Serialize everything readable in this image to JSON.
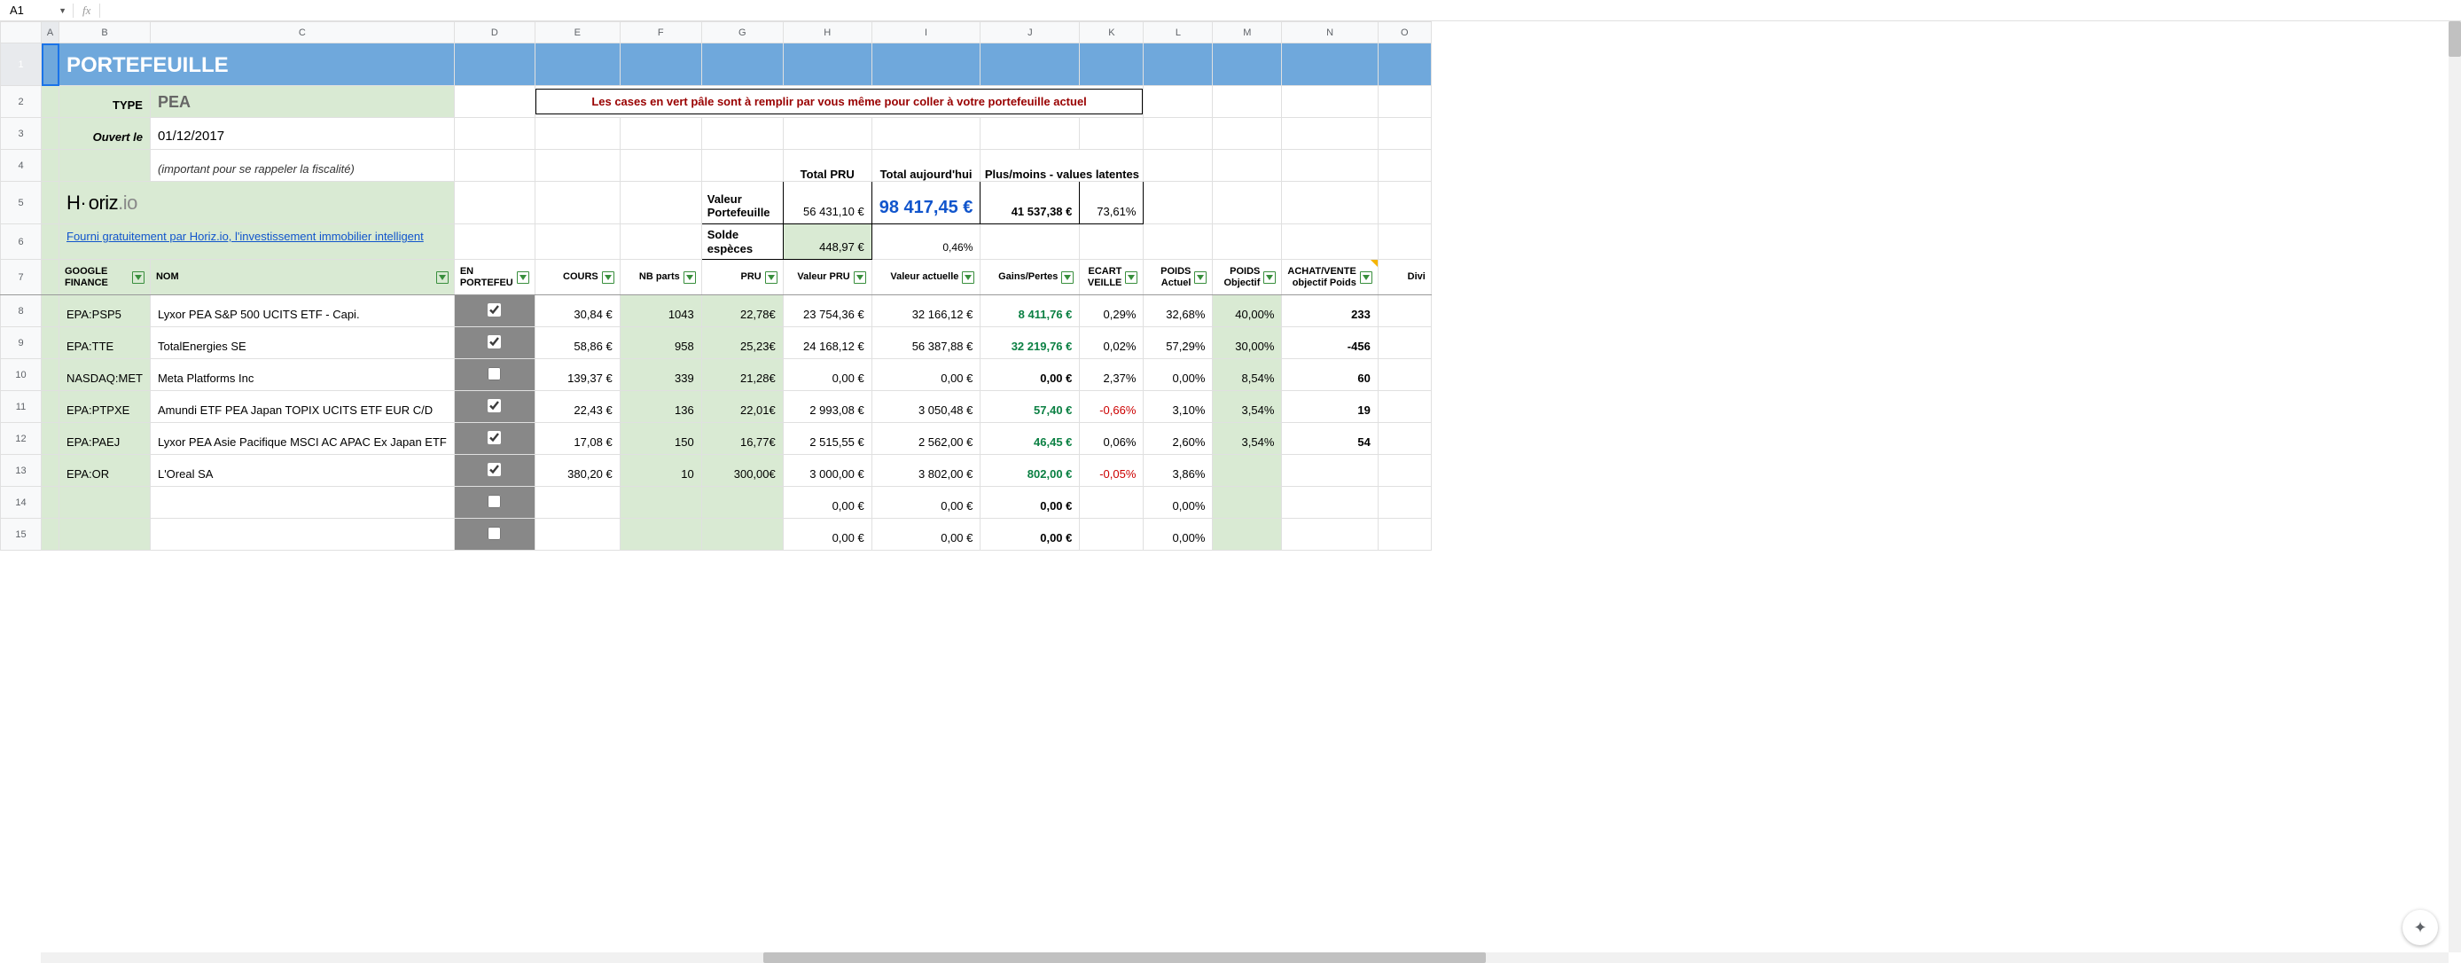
{
  "nameBox": "A1",
  "title": "PORTEFEUILLE",
  "typeLabel": "TYPE",
  "typeValue": "PEA",
  "openLabel": "Ouvert le",
  "openDate": "01/12/2017",
  "openNote": "(important pour se rappeler la fiscalité)",
  "logo": "Horiz.io",
  "logoL1": "H",
  "logoL2": "oriz",
  "logoL3": ".io",
  "link": "Fourni gratuitement par Horiz.io, l'investissement immobilier intelligent",
  "callout": "Les cases en vert pâle sont à remplir par vous même pour coller à votre portefeuille actuel",
  "sumHdr": {
    "pru": "Total PRU",
    "today": "Total aujourd'hui",
    "pm": "Plus/moins - values latentes"
  },
  "sumRows": {
    "valeur": {
      "label": "Valeur Portefeuille",
      "pru": "56 431,10 €",
      "today": "98 417,45 €",
      "pm": "41 537,38 €",
      "pct": "73,61%"
    },
    "solde": {
      "label": "Solde espèces",
      "val": "448,97 €",
      "pct": "0,46%"
    }
  },
  "columns": {
    "google": "GOOGLE FINANCE",
    "nom": "NOM",
    "enport": "EN PORTEFEU",
    "cours": "COURS",
    "nbparts": "NB parts",
    "pru": "PRU",
    "valpru": "Valeur PRU",
    "valact": "Valeur actuelle",
    "gains": "Gains/Pertes",
    "ecart": "ECART VEILLE",
    "pact": "POIDS Actuel",
    "pobj": "POIDS Objectif",
    "achat": "ACHAT/VENTE objectif Poids",
    "divi": "Divi"
  },
  "rows": [
    {
      "sym": "EPA:PSP5",
      "nom": "Lyxor PEA S&P 500 UCITS ETF - Capi.",
      "chk": true,
      "cours": "30,84  €",
      "nb": "1043",
      "pru": "22,78€",
      "vpru": "23 754,36 €",
      "vact": "32 166,12 €",
      "gp": "8 411,76 €",
      "gpc": "green",
      "ecart": "0,29%",
      "ecartc": "",
      "pa": "32,68%",
      "po": "40,00%",
      "av": "233"
    },
    {
      "sym": "EPA:TTE",
      "nom": "TotalEnergies SE",
      "chk": true,
      "cours": "58,86  €",
      "nb": "958",
      "pru": "25,23€",
      "vpru": "24 168,12 €",
      "vact": "56 387,88 €",
      "gp": "32 219,76 €",
      "gpc": "green",
      "ecart": "0,02%",
      "ecartc": "",
      "pa": "57,29%",
      "po": "30,00%",
      "av": "-456"
    },
    {
      "sym": "NASDAQ:MET",
      "nom": "Meta Platforms Inc",
      "chk": false,
      "cours": "139,37  €",
      "nb": "339",
      "pru": "21,28€",
      "vpru": "0,00 €",
      "vact": "0,00 €",
      "gp": "0,00 €",
      "gpc": "",
      "ecart": "2,37%",
      "ecartc": "",
      "pa": "0,00%",
      "po": "8,54%",
      "av": "60"
    },
    {
      "sym": "EPA:PTPXE",
      "nom": "Amundi ETF PEA Japan TOPIX UCITS ETF EUR C/D",
      "chk": true,
      "cours": "22,43  €",
      "nb": "136",
      "pru": "22,01€",
      "vpru": "2 993,08 €",
      "vact": "3 050,48 €",
      "gp": "57,40 €",
      "gpc": "green",
      "ecart": "-0,66%",
      "ecartc": "red",
      "pa": "3,10%",
      "po": "3,54%",
      "av": "19"
    },
    {
      "sym": "EPA:PAEJ",
      "nom": "Lyxor PEA Asie Pacifique MSCI AC APAC Ex Japan ETF",
      "chk": true,
      "cours": "17,08  €",
      "nb": "150",
      "pru": "16,77€",
      "vpru": "2 515,55 €",
      "vact": "2 562,00 €",
      "gp": "46,45 €",
      "gpc": "green",
      "ecart": "0,06%",
      "ecartc": "",
      "pa": "2,60%",
      "po": "3,54%",
      "av": "54"
    },
    {
      "sym": "EPA:OR",
      "nom": "L'Oreal SA",
      "chk": true,
      "cours": "380,20  €",
      "nb": "10",
      "pru": "300,00€",
      "vpru": "3 000,00 €",
      "vact": "3 802,00 €",
      "gp": "802,00 €",
      "gpc": "green",
      "ecart": "-0,05%",
      "ecartc": "red",
      "pa": "3,86%",
      "po": "",
      "av": ""
    },
    {
      "sym": "",
      "nom": "",
      "chk": false,
      "cours": "",
      "nb": "",
      "pru": "",
      "vpru": "0,00 €",
      "vact": "0,00 €",
      "gp": "0,00 €",
      "gpc": "",
      "ecart": "",
      "ecartc": "",
      "pa": "0,00%",
      "po": "",
      "av": ""
    },
    {
      "sym": "",
      "nom": "",
      "chk": false,
      "cours": "",
      "nb": "",
      "pru": "",
      "vpru": "0,00 €",
      "vact": "0,00 €",
      "gp": "0,00 €",
      "gpc": "",
      "ecart": "",
      "ecartc": "",
      "pa": "0,00%",
      "po": "",
      "av": ""
    }
  ],
  "colLetters": [
    "A",
    "B",
    "C",
    "D",
    "E",
    "F",
    "G",
    "H",
    "I",
    "J",
    "K",
    "L",
    "M",
    "N",
    "O"
  ]
}
